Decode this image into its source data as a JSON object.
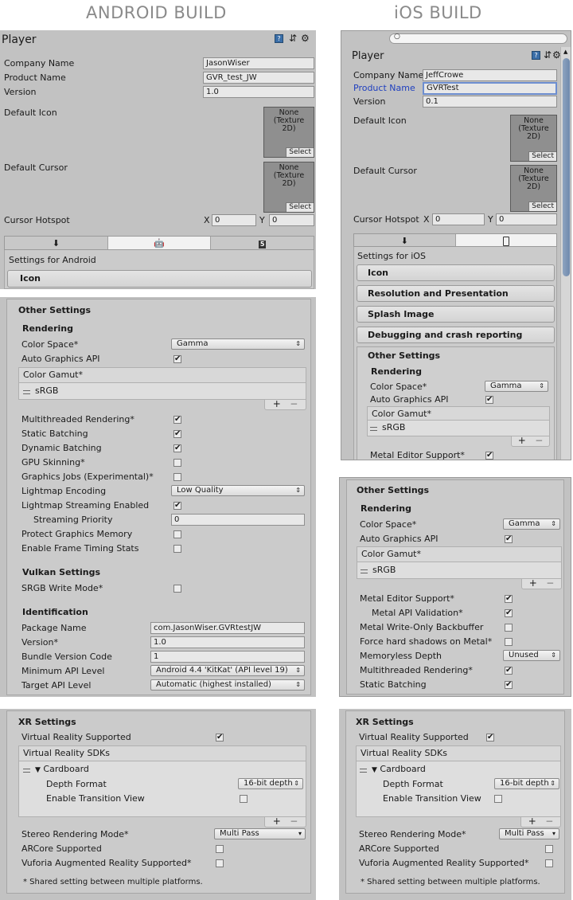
{
  "titles": {
    "android": "ANDROID BUILD",
    "ios": "iOS BUILD"
  },
  "colors": {
    "panel": "#c2c2c2",
    "focus_blue": "#6d8ed0",
    "label_blue": "#1f3fbf"
  },
  "icons": {
    "help": "help-book-icon",
    "preset": "preset-sliders-icon",
    "gear": "gear-icon",
    "download": "download-arrow-icon",
    "android": "android-robot-icon",
    "html5": "html5-icon",
    "iphone": "iphone-icon",
    "search": "search-icon",
    "foldout": "foldout-triangle-icon",
    "drag": "drag-handle-icon"
  },
  "common": {
    "player": "Player",
    "company_name": "Company Name",
    "product_name": "Product Name",
    "version": "Version",
    "default_icon": "Default Icon",
    "default_cursor": "Default Cursor",
    "cursor_hotspot": "Cursor Hotspot",
    "x": "X",
    "y": "Y",
    "zero": "0",
    "none_texture": "None\n(Texture\n2D)",
    "none_texture_ios": "None (Texture\n2D)",
    "select": "Select",
    "icon": "Icon",
    "other_settings": "Other Settings",
    "rendering": "Rendering",
    "color_space": "Color Space*",
    "gamma": "Gamma",
    "auto_graphics_api": "Auto Graphics API",
    "color_gamut": "Color Gamut*",
    "srgb": "sRGB",
    "plus": "+",
    "minus": "−",
    "check": "✔",
    "multithreaded_rendering": "Multithreaded Rendering*",
    "static_batching": "Static Batching",
    "dynamic_batching": "Dynamic Batching",
    "gpu_skinning": "GPU Skinning*",
    "graphics_jobs": "Graphics Jobs (Experimental)*",
    "lightmap_encoding": "Lightmap Encoding",
    "low_quality": "Low Quality",
    "lightmap_streaming_enabled": "Lightmap Streaming Enabled",
    "streaming_priority": "Streaming Priority",
    "protect_graphics_memory": "Protect Graphics Memory",
    "enable_frame_timing_stats": "Enable Frame Timing Stats",
    "vulkan_settings": "Vulkan Settings",
    "srgb_write_mode": "SRGB Write Mode*",
    "identification": "Identification",
    "package_name": "Package Name",
    "version_star": "Version*",
    "bundle_version_code": "Bundle Version Code",
    "minimum_api_level": "Minimum API Level",
    "target_api_level": "Target API Level",
    "xr_settings": "XR Settings",
    "virtual_reality_supported": "Virtual Reality Supported",
    "virtual_reality_sdks": "Virtual Reality SDKs",
    "cardboard": "Cardboard",
    "depth_format": "Depth Format",
    "depth_value": "16-bit depth",
    "enable_transition_view": "Enable Transition View",
    "stereo_rendering_mode": "Stereo Rendering Mode*",
    "multi_pass": "Multi Pass",
    "arcore_supported": "ARCore Supported",
    "vuforia_supported": "Vuforia Augmented Reality Supported*",
    "shared_note": "* Shared setting between multiple platforms.",
    "arrow": "▼",
    "updown": "⇕",
    "down": "▾"
  },
  "android": {
    "company": "JasonWiser",
    "product": "GVR_test_JW",
    "version": "1.0",
    "settings_for": "Settings for Android",
    "streaming_priority_value": "0",
    "package_name_value": "com.JasonWiser.GVRtestJW",
    "version_value": "1.0",
    "bundle_version_code_value": "1",
    "minimum_api_value": "Android 4.4 'KitKat' (API level 19)",
    "target_api_value": "Automatic (highest installed)"
  },
  "ios": {
    "company": "JeffCrowe",
    "product": "GVRTest",
    "version": "0.1",
    "settings_for": "Settings for iOS",
    "resolution": "Resolution and Presentation",
    "splash": "Splash Image",
    "debugging": "Debugging and crash reporting",
    "metal_editor_support": "Metal Editor Support*",
    "metal_api_validation": "Metal API Validation*",
    "metal_write_only": "Metal Write-Only Backbuffer",
    "force_hard_shadows": "Force hard shadows on Metal*",
    "memoryless_depth": "Memoryless Depth",
    "unused": "Unused"
  }
}
